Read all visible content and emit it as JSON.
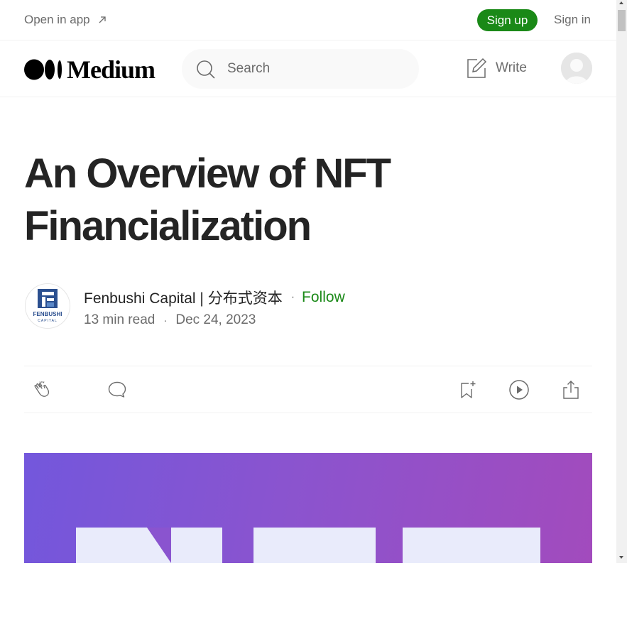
{
  "topbar": {
    "open_in_app": "Open in app",
    "sign_up": "Sign up",
    "sign_in": "Sign in"
  },
  "nav": {
    "logo": "Medium",
    "search_placeholder": "Search",
    "write": "Write"
  },
  "article": {
    "title": "An Overview of NFT Financialization",
    "author": "Fenbushi Capital | 分布式资本",
    "follow": "Follow",
    "read_time": "13 min read",
    "date": "Dec 24, 2023",
    "author_logo_text": [
      "FENBUSHI",
      "CAPITAL"
    ]
  },
  "colors": {
    "accent": "#1a8917",
    "text": "#242424",
    "muted": "#6b6b6b",
    "hero_start": "#7357dc",
    "hero_end": "#a24bbd"
  },
  "icons": [
    "external-arrow-icon",
    "medium-logo-icon",
    "search-icon",
    "write-icon",
    "user-avatar-icon",
    "clap-icon",
    "comment-icon",
    "bookmark-add-icon",
    "play-icon",
    "share-icon"
  ]
}
